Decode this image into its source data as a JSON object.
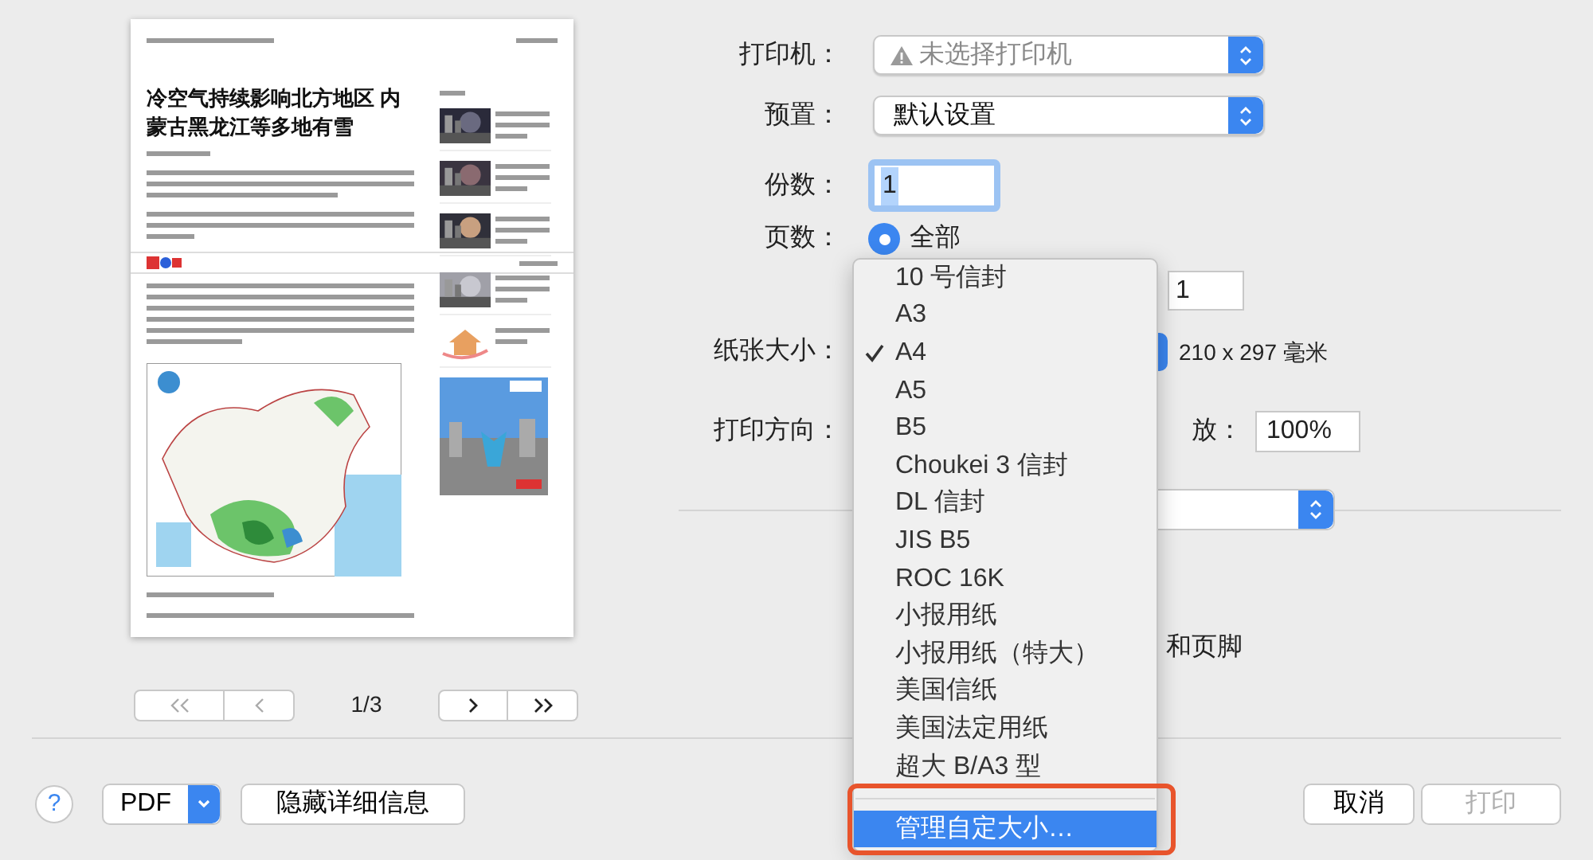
{
  "preview": {
    "headline": "冷空气持续影响北方地区 内蒙古黑龙江等多地有雪",
    "page_indicator": "1/3"
  },
  "form": {
    "printer": {
      "label": "打印机：",
      "value": "未选择打印机",
      "warning": true
    },
    "preset": {
      "label": "预置：",
      "value": "默认设置"
    },
    "copies": {
      "label": "份数：",
      "value": "1",
      "focused": true
    },
    "pages": {
      "label": "页数：",
      "option": "全部",
      "selected": true,
      "to_value": "1"
    },
    "paper_size": {
      "label": "纸张大小：",
      "dimensions": "210 x 297 毫米"
    },
    "orientation": {
      "label": "打印方向："
    },
    "scale": {
      "label": "放：",
      "value": "100%"
    },
    "headers_footers": {
      "label": "和页脚"
    }
  },
  "paper_menu": {
    "items": [
      {
        "label": "10 号信封",
        "checked": false
      },
      {
        "label": "A3",
        "checked": false
      },
      {
        "label": "A4",
        "checked": true
      },
      {
        "label": "A5",
        "checked": false
      },
      {
        "label": "B5",
        "checked": false
      },
      {
        "label": "Choukei 3 信封",
        "checked": false
      },
      {
        "label": "DL 信封",
        "checked": false
      },
      {
        "label": "JIS B5",
        "checked": false
      },
      {
        "label": "ROC 16K",
        "checked": false
      },
      {
        "label": "小报用纸",
        "checked": false
      },
      {
        "label": "小报用纸（特大）",
        "checked": false
      },
      {
        "label": "美国信纸",
        "checked": false
      },
      {
        "label": "美国法定用纸",
        "checked": false
      },
      {
        "label": "超大 B/A3 型",
        "checked": false
      }
    ],
    "footer_item": {
      "label": "管理自定大小…",
      "selected": true
    }
  },
  "buttons": {
    "help": "?",
    "pdf": "PDF",
    "hide_details": "隐藏详细信息",
    "cancel": "取消",
    "print": {
      "label": "打印",
      "disabled": true
    }
  }
}
